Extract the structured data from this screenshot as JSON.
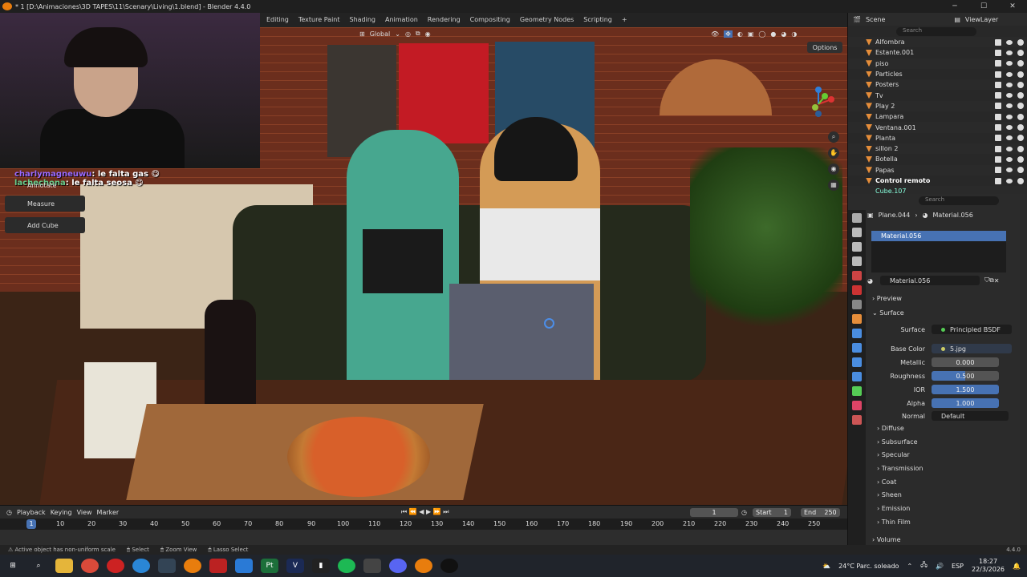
{
  "window": {
    "title": "* 1 [D:\\Animaciones\\3D TAPES\\11\\Scenary\\Living\\1.blend] - Blender 4.4.0",
    "min": "─",
    "max": "☐",
    "close": "✕"
  },
  "workspaces": [
    "Editing",
    "Texture Paint",
    "Shading",
    "Animation",
    "Rendering",
    "Compositing",
    "Geometry Nodes",
    "Scripting",
    "+"
  ],
  "header_right": {
    "scene": "Scene",
    "viewlayer": "ViewLayer"
  },
  "viewport": {
    "orientation": "Global",
    "options": "Options"
  },
  "chat": [
    {
      "user": "charlymagneuwu",
      "msg": "le falta gas"
    },
    {
      "user": "lachechona",
      "msg": "le falta seosa"
    }
  ],
  "tools": {
    "annotate": "Annotate",
    "measure": "Measure",
    "add_cube": "Add Cube"
  },
  "outliner": {
    "search": "Search",
    "items": [
      "Alfombra",
      "Estante.001",
      "piso",
      "Particles",
      "Posters",
      "Tv",
      "Play 2",
      "Lampara",
      "Ventana.001",
      "Planta",
      "sillon 2",
      "Botella",
      "Papas",
      "Control remoto",
      "Cube.107"
    ]
  },
  "properties": {
    "object": "Plane.044",
    "material_header": "Material.056",
    "slot": "Material.056",
    "material_name": "Material.056",
    "search": "Search",
    "preview": "Preview",
    "surface_section": "Surface",
    "surface_label": "Surface",
    "surface_value": "Principled BSDF",
    "base_color_label": "Base Color",
    "base_color_value": "5.jpg",
    "metallic_label": "Metallic",
    "metallic": "0.000",
    "roughness_label": "Roughness",
    "roughness": "0.500",
    "ior_label": "IOR",
    "ior": "1.500",
    "alpha_label": "Alpha",
    "alpha": "1.000",
    "normal_label": "Normal",
    "normal": "Default",
    "subsections": [
      "Diffuse",
      "Subsurface",
      "Specular",
      "Transmission",
      "Coat",
      "Sheen",
      "Emission",
      "Thin Film"
    ],
    "volume": "Volume"
  },
  "timeline": {
    "playback": "Playback",
    "keying": "Keying",
    "view": "View",
    "marker": "Marker",
    "frame": "1",
    "start_label": "Start",
    "start": "1",
    "end_label": "End",
    "end": "250",
    "ticks": [
      "1",
      "10",
      "20",
      "30",
      "40",
      "50",
      "60",
      "70",
      "80",
      "90",
      "100",
      "110",
      "120",
      "130",
      "140",
      "150",
      "160",
      "170",
      "180",
      "190",
      "200",
      "210",
      "220",
      "230",
      "240",
      "250"
    ]
  },
  "status": {
    "msg": "Active object has non-uniform scale",
    "select": "Select",
    "zoom": "Zoom View",
    "lasso": "Lasso Select",
    "version": "4.4.0"
  },
  "taskbar": {
    "weather": "24°C  Parc. soleado",
    "lang": "ESP",
    "time": "18:27",
    "date": "22/3/2026"
  },
  "colors": {
    "accent": "#4772b3",
    "orange": "#e58d3a"
  }
}
